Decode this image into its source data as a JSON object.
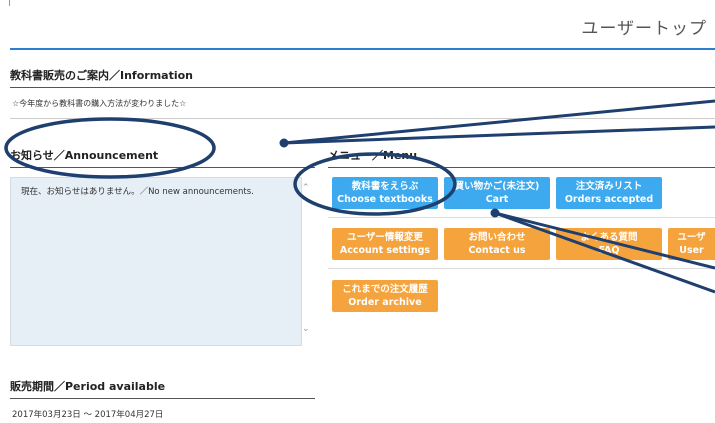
{
  "header": {
    "title": "ユーザートップ"
  },
  "info": {
    "title": "教科書販売のご案内／Information",
    "note": "☆今年度から教科書の購入方法が変わりました☆"
  },
  "announcement": {
    "title": "お知らせ／Announcement",
    "text": "現在、お知らせはありません。／No new announcements."
  },
  "menu": {
    "title": "メニュー／Menu",
    "buttons": [
      {
        "jp": "教科書をえらぶ",
        "en": "Choose textbooks",
        "color": "#3da9ee"
      },
      {
        "jp": "買い物かご(未注文)",
        "en": "Cart",
        "color": "#3da9ee"
      },
      {
        "jp": "注文済みリスト",
        "en": "Orders accepted",
        "color": "#3da9ee"
      },
      {
        "jp": "ユーザー情報変更",
        "en": "Account settings",
        "color": "#f5a33c"
      },
      {
        "jp": "お問い合わせ",
        "en": "Contact us",
        "color": "#f5a33c"
      },
      {
        "jp": "よくある質問",
        "en": "FAQ",
        "color": "#f5a33c"
      },
      {
        "jp": "ユーザ",
        "en": "User",
        "color": "#f5a33c"
      },
      {
        "jp": "これまでの注文履歴",
        "en": "Order archive",
        "color": "#f5a33c"
      }
    ]
  },
  "period": {
    "title": "販売期間／Period available",
    "dates": "2017年03月23日 ～ 2017年04月27日"
  },
  "colors": {
    "accent": "#2a7fd1",
    "annotation": "#1f3f6e"
  }
}
